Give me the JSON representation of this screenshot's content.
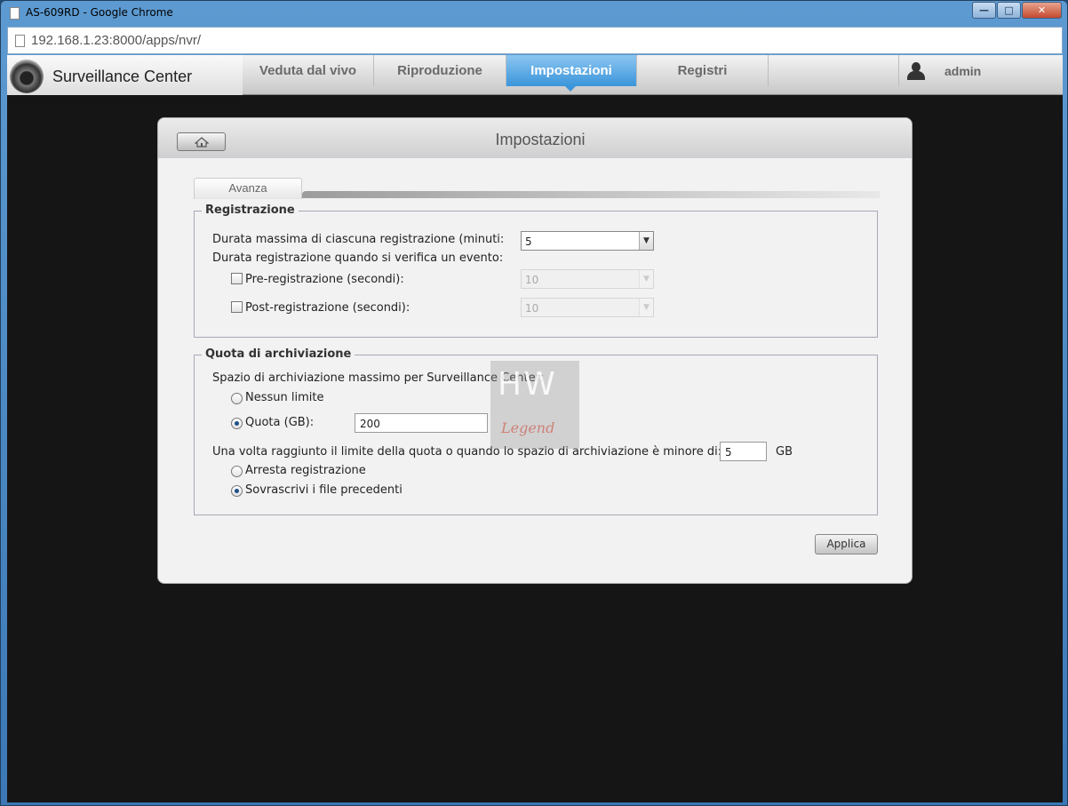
{
  "window": {
    "title": "AS-609RD - Google Chrome",
    "minimize_icon": "minimize-icon",
    "maximize_icon": "maximize-icon",
    "close_icon": "close-icon"
  },
  "browser": {
    "url": "192.168.1.23:8000/apps/nvr/"
  },
  "app": {
    "brand": "Surveillance Center",
    "nav_tabs": [
      {
        "label": "Veduta dal vivo",
        "active": false
      },
      {
        "label": "Riproduzione",
        "active": false
      },
      {
        "label": "Impostazioni",
        "active": true
      },
      {
        "label": "Registri",
        "active": false
      }
    ],
    "user": "admin",
    "accent_color": "#3b95db"
  },
  "panel": {
    "title": "Impostazioni",
    "tab": "Avanza",
    "recording": {
      "legend": "Registrazione",
      "max_duration_label": "Durata massima di ciascuna registrazione (minuti:",
      "max_duration_value": "5",
      "event_label": "Durata registrazione quando si verifica un evento:",
      "pre_label": "Pre-registrazione (secondi):",
      "pre_value": "10",
      "pre_checked": false,
      "post_label": "Post-registrazione (secondi):",
      "post_value": "10",
      "post_checked": false
    },
    "quota": {
      "legend": "Quota di archiviazione",
      "space_label": "Spazio di archiviazione massimo per Surveillance Center:",
      "no_limit_label": "Nessun limite",
      "quota_label": "Quota (GB):",
      "quota_value": "200",
      "selected": "quota",
      "limit_label": "Una volta raggiunto il limite della quota o quando lo spazio di archiviazione è minore di:",
      "limit_value": "5",
      "limit_unit": "GB",
      "stop_label": "Arresta registrazione",
      "overwrite_label": "Sovrascrivi i file precedenti",
      "action_selected": "overwrite"
    },
    "apply_label": "Applica"
  },
  "watermark": {
    "top": "HW",
    "bottom": "Legend"
  }
}
